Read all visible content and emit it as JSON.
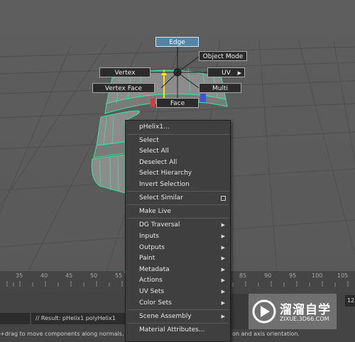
{
  "marking_menu": {
    "edge": "Edge",
    "object_mode": "Object Mode",
    "vertex": "Vertex",
    "uv": "UV",
    "vertex_face": "Vertex Face",
    "multi": "Multi",
    "face": "Face"
  },
  "context_menu": {
    "title": "pHelix1...",
    "select": "Select",
    "select_all": "Select All",
    "deselect_all": "Deselect All",
    "select_hierarchy": "Select Hierarchy",
    "invert_selection": "Invert Selection",
    "select_similar": "Select Similar",
    "make_live": "Make Live",
    "dg_traversal": "DG Traversal",
    "inputs": "Inputs",
    "outputs": "Outputs",
    "paint": "Paint",
    "metadata": "Metadata",
    "actions": "Actions",
    "uv_sets": "UV Sets",
    "color_sets": "Color Sets",
    "scene_assembly": "Scene Assembly",
    "material_attributes": "Material Attributes..."
  },
  "timeline": {
    "ticks": [
      "35",
      "40",
      "45",
      "50",
      "55",
      "85",
      "90",
      "95",
      "100",
      "105"
    ],
    "frame_value": "12"
  },
  "status": {
    "result": "// Result: pHelix1 polyHelix1",
    "help_left": "+drag to move components along normals. Us",
    "help_right": "on and axis orientation."
  },
  "watermark": {
    "title": "溜溜自学",
    "sub": "ZIXUE.3D66.COM"
  },
  "colors": {
    "highlight": "#5285a6",
    "wire": "#34e8a0",
    "viewport_bg": "#5e5e5e"
  }
}
